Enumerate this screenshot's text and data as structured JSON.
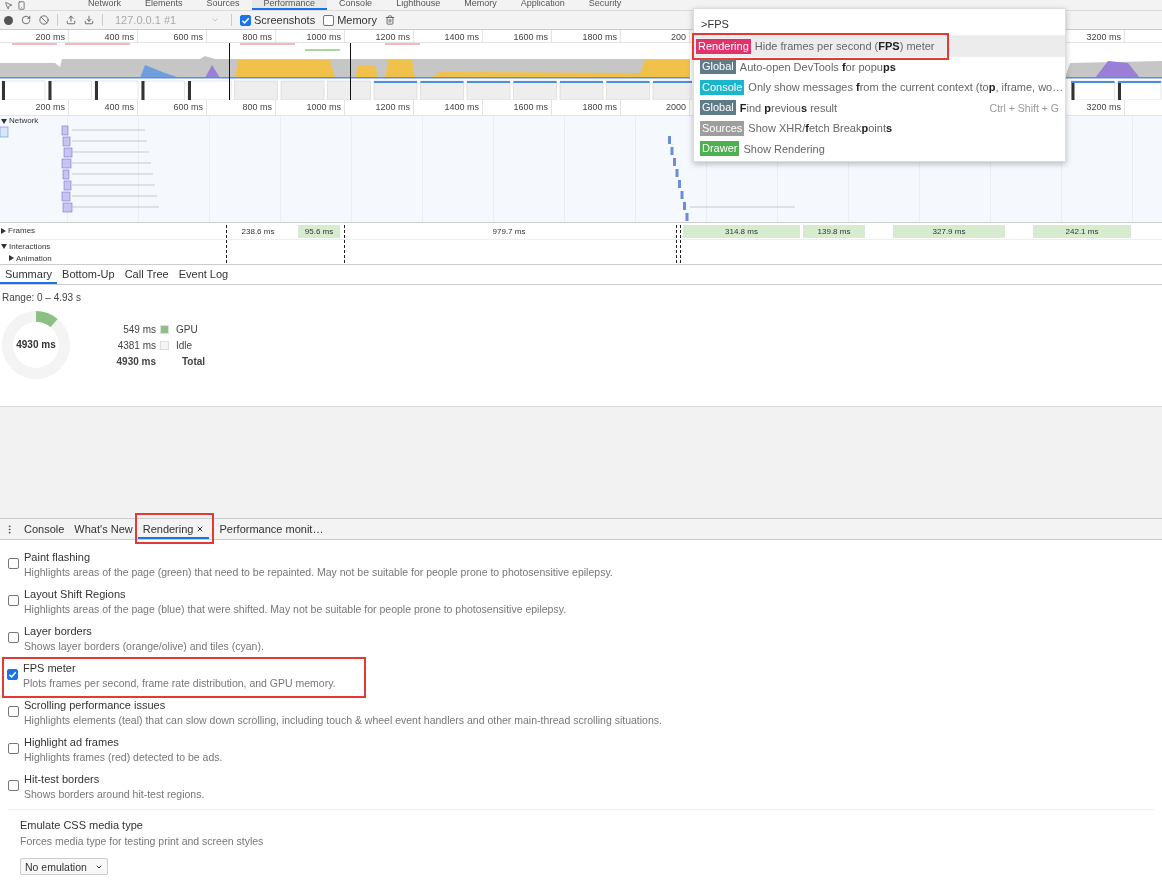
{
  "top_tabs": [
    {
      "label": "Network",
      "selected": false
    },
    {
      "label": "Elements",
      "selected": false
    },
    {
      "label": "Sources",
      "selected": false
    },
    {
      "label": "Performance",
      "selected": true
    },
    {
      "label": "Console",
      "selected": false
    },
    {
      "label": "Lighthouse",
      "selected": false
    },
    {
      "label": "Memory",
      "selected": false
    },
    {
      "label": "Application",
      "selected": false
    },
    {
      "label": "Security",
      "selected": false
    }
  ],
  "toolbar": {
    "target": "127.0.0.1 #1",
    "options": [
      {
        "label": "Screenshots",
        "checked": true
      },
      {
        "label": "Memory",
        "checked": false
      }
    ]
  },
  "overview": {
    "ticks": [
      "200 ms",
      "400 ms",
      "600 ms",
      "800 ms",
      "1000 ms",
      "1200 ms",
      "1400 ms",
      "1600 ms",
      "1800 ms",
      "200"
    ],
    "right_ticks": [
      "3200 ms"
    ]
  },
  "ruler": {
    "ticks": [
      "200 ms",
      "400 ms",
      "600 ms",
      "800 ms",
      "1000 ms",
      "1200 ms",
      "1400 ms",
      "1600 ms",
      "1800 ms",
      "2000"
    ],
    "right_ticks": [
      "3200 ms"
    ]
  },
  "network_track": {
    "label": "Network",
    "expanded": true
  },
  "frames_track": {
    "label": "Frames",
    "expanded": false,
    "frames": [
      {
        "duration": "238.6 ms",
        "kind": "plain"
      },
      {
        "duration": "95.6 ms",
        "kind": "good"
      },
      {
        "duration": "979.7 ms",
        "kind": "plain"
      },
      {
        "duration": "314.8 ms",
        "kind": "good"
      },
      {
        "duration": "139.8 ms",
        "kind": "good"
      },
      {
        "duration": "327.9 ms",
        "kind": "good"
      },
      {
        "duration": "242.1 ms",
        "kind": "good"
      }
    ]
  },
  "interactions_track": {
    "label": "Interactions",
    "expanded": true,
    "children": [
      {
        "label": "Animation",
        "expanded": false
      }
    ]
  },
  "details_tabs": [
    {
      "label": "Summary",
      "selected": true
    },
    {
      "label": "Bottom-Up",
      "selected": false
    },
    {
      "label": "Call Tree",
      "selected": false
    },
    {
      "label": "Event Log",
      "selected": false
    }
  ],
  "summary": {
    "range": "Range: 0 – 4.93 s",
    "center": "4930 ms",
    "chart_data": {
      "type": "donut",
      "categories": [
        "GPU",
        "Idle"
      ],
      "values": [
        11.1,
        88.9
      ]
    },
    "legend": [
      {
        "value": "549 ms",
        "color": "#8cc084"
      },
      {
        "value": "4381 ms",
        "color": "#f4f4f4"
      }
    ],
    "total": {
      "value": "4930 ms",
      "label": "Total"
    }
  },
  "drawer_tabs": [
    {
      "label": "Console",
      "selected": false,
      "closable": false,
      "annotated": false
    },
    {
      "label": "What's New",
      "selected": false,
      "closable": false,
      "annotated": false
    },
    {
      "label": "Rendering",
      "selected": true,
      "closable": true,
      "annotated": true
    },
    {
      "label": "Performance monit…",
      "selected": false,
      "closable": false,
      "annotated": false
    }
  ],
  "rendering": {
    "settings": [
      {
        "label": "Paint flashing",
        "description": "Highlights areas of the page (green) that need to be repainted. May not be suitable for people prone to photosensitive epilepsy.",
        "checked": false,
        "annotated": false
      },
      {
        "label": "Layout Shift Regions",
        "description": "Highlights areas of the page (blue) that were shifted. May not be suitable for people prone to photosensitive epilepsy.",
        "checked": false,
        "annotated": false
      },
      {
        "label": "Layer borders",
        "description": "Shows layer borders (orange/olive) and tiles (cyan).",
        "checked": false,
        "annotated": false
      },
      {
        "label": "FPS meter",
        "description": "Plots frames per second, frame rate distribution, and GPU memory.",
        "checked": true,
        "annotated": true
      },
      {
        "label": "Scrolling performance issues",
        "description": "Highlights elements (teal) that can slow down scrolling, including touch & wheel event handlers and other main-thread scrolling situations.",
        "checked": false,
        "annotated": false
      },
      {
        "label": "Highlight ad frames",
        "description": "Highlights frames (red) detected to be ads.",
        "checked": false,
        "annotated": false
      },
      {
        "label": "Hit-test borders",
        "description": "Shows borders around hit-test regions.",
        "checked": false,
        "annotated": false
      }
    ],
    "media": {
      "label": "Emulate CSS media type",
      "description": "Forces media type for testing print and screen styles",
      "value": "No emulation"
    }
  },
  "command_menu": {
    "query": ">FPS",
    "items": [
      {
        "category": "Rendering",
        "color": "#e0336b",
        "text": "Hide frames per second (**FPS**) meter",
        "selected": true,
        "annotated": true
      },
      {
        "category": "Global",
        "color": "#5f7b88",
        "text": "Auto-open DevTools **f**or popu**ps**",
        "selected": false,
        "annotated": false
      },
      {
        "category": "Console",
        "color": "#1ab6cc",
        "text": "Only show messages **f**rom the current context (to**p**, iframe, wo…",
        "selected": false,
        "annotated": false
      },
      {
        "category": "Global",
        "color": "#5f7b88",
        "text": "**F**ind **p**reviou**s** result",
        "shortcut": "Ctrl + Shift + G",
        "selected": false,
        "annotated": false
      },
      {
        "category": "Sources",
        "color": "#9e9e9e",
        "text": "Show XHR/**f**etch Break**p**oint**s**",
        "selected": false,
        "annotated": false
      },
      {
        "category": "Drawer",
        "color": "#4caf50",
        "text": "Show Rendering",
        "selected": false,
        "annotated": false
      }
    ]
  }
}
